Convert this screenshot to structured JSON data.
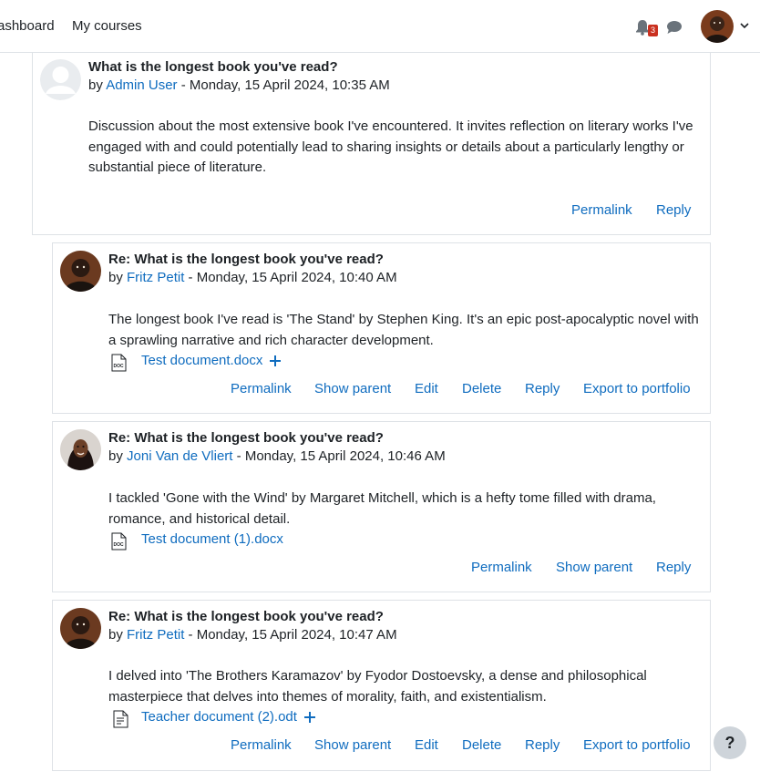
{
  "navbar": {
    "dashboard_label": "ashboard",
    "my_courses_label": "My courses",
    "notification_count": "3"
  },
  "posts": [
    {
      "subject": "What is the longest book you've read?",
      "by_prefix": "by",
      "author": "Admin User",
      "date": "- Monday, 15 April 2024, 10:35 AM",
      "message": "Discussion about the most extensive book I've encountered. It invites reflection on literary works I've engaged with and could potentially lead to sharing insights or details about a particularly lengthy or substantial piece of literature.",
      "actions": [
        "Permalink",
        "Reply"
      ]
    },
    {
      "subject": "Re: What is the longest book you've read?",
      "by_prefix": "by",
      "author": "Fritz Petit",
      "date": "- Monday, 15 April 2024, 10:40 AM",
      "message": "The longest book I've read is 'The Stand' by Stephen King. It's an epic post-apocalyptic novel with a sprawling narrative and rich character development.",
      "attachment": "Test document.docx",
      "actions": [
        "Permalink",
        "Show parent",
        "Edit",
        "Delete",
        "Reply",
        "Export to portfolio"
      ]
    },
    {
      "subject": "Re: What is the longest book you've read?",
      "by_prefix": "by",
      "author": "Joni Van de Vliert",
      "date": "- Monday, 15 April 2024, 10:46 AM",
      "message": "I tackled 'Gone with the Wind' by Margaret Mitchell, which is a hefty tome filled with drama, romance, and historical detail.",
      "attachment": "Test document (1).docx",
      "actions": [
        "Permalink",
        "Show parent",
        "Reply"
      ]
    },
    {
      "subject": "Re: What is the longest book you've read?",
      "by_prefix": "by",
      "author": "Fritz Petit",
      "date": "- Monday, 15 April 2024, 10:47 AM",
      "message": "I delved into 'The Brothers Karamazov' by Fyodor Dostoevsky, a dense and philosophical masterpiece that delves into themes of morality, faith, and existentialism.",
      "attachment": "Teacher document (2).odt",
      "actions": [
        "Permalink",
        "Show parent",
        "Edit",
        "Delete",
        "Reply",
        "Export to portfolio"
      ]
    }
  ],
  "help_label": "?",
  "colors": {
    "link": "#0f6cbf",
    "badge": "#ca3120",
    "border": "#dee2e6"
  }
}
